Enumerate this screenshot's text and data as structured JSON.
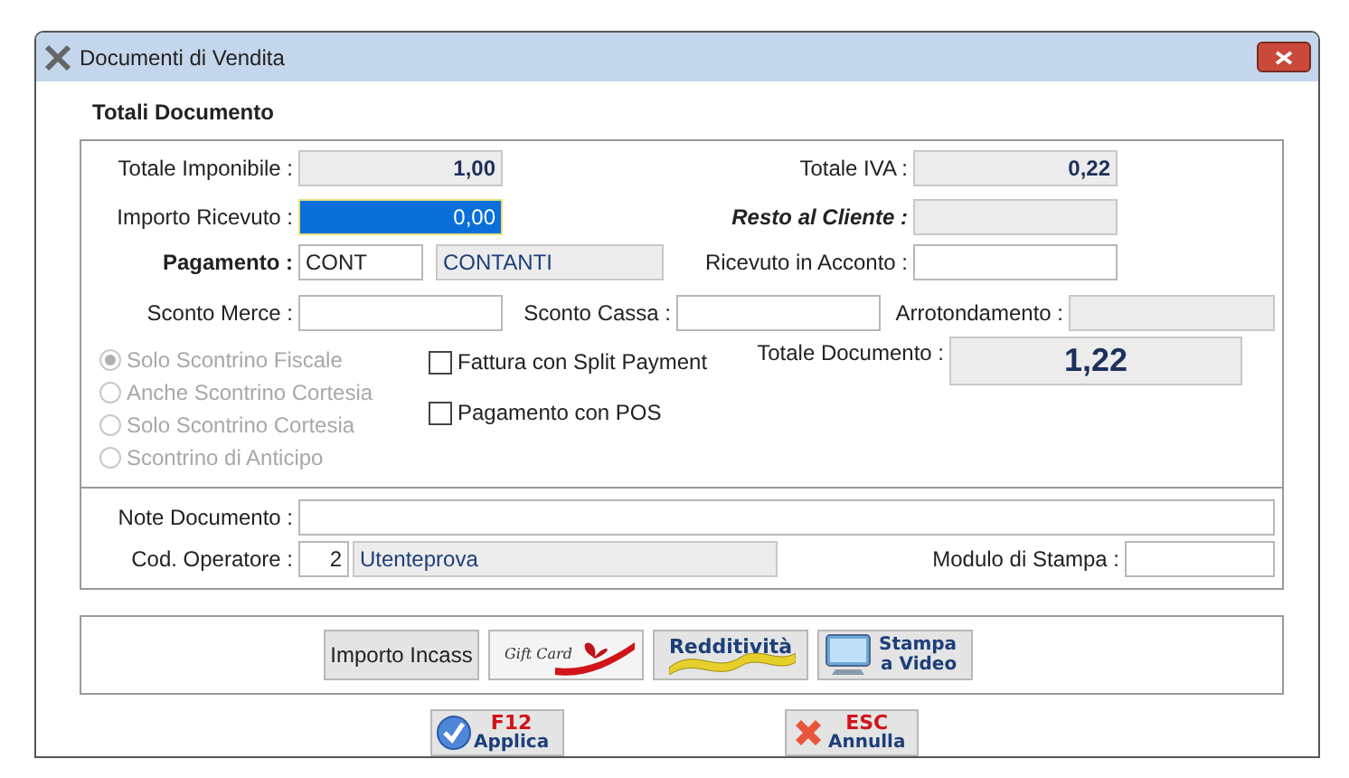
{
  "window": {
    "title": "Documenti di Vendita"
  },
  "section_title": "Totali Documento",
  "totals": {
    "imponibile": {
      "label": "Totale Imponibile :",
      "value": "1,00"
    },
    "iva": {
      "label": "Totale IVA :",
      "value": "0,22"
    },
    "ricevuto": {
      "label": "Importo Ricevuto :",
      "value": "0,00",
      "selected": true
    },
    "resto": {
      "label": "Resto al Cliente :"
    },
    "pagamento": {
      "label": "Pagamento :",
      "code": "CONT",
      "name": "CONTANTI"
    },
    "acconto": {
      "label": "Ricevuto in Acconto :"
    },
    "sconto_merce": {
      "label": "Sconto Merce :"
    },
    "sconto_cassa": {
      "label": "Sconto Cassa :"
    },
    "arrotondamento": {
      "label": "Arrotondamento :"
    }
  },
  "receipt_options": [
    {
      "label": "Solo Scontrino Fiscale",
      "selected": true,
      "disabled": true
    },
    {
      "label": "Anche Scontrino Cortesia",
      "selected": false,
      "disabled": true
    },
    {
      "label": "Solo Scontrino Cortesia",
      "selected": false,
      "disabled": true
    },
    {
      "label": "Scontrino di Anticipo",
      "selected": false,
      "disabled": true
    }
  ],
  "checkboxes": [
    {
      "label": "Fattura con Split Payment",
      "checked": false
    },
    {
      "label": "Pagamento con POS",
      "checked": false
    }
  ],
  "totale_documento": {
    "label": "Totale Documento :",
    "value": "1,22"
  },
  "note": {
    "label": "Note Documento :"
  },
  "operatore": {
    "label": "Cod. Operatore :",
    "code": "2",
    "name": "Utenteprova"
  },
  "modulo": {
    "label": "Modulo di Stampa :"
  },
  "tool_buttons": [
    {
      "kind": "plain",
      "label": "Importo Incass"
    },
    {
      "kind": "giftcard",
      "label": "Gift Card"
    },
    {
      "kind": "tape",
      "label": "Redditività"
    },
    {
      "kind": "monitor",
      "label": "Stampa",
      "label2": "a Video"
    }
  ],
  "actions": [
    {
      "kind": "apply",
      "key": "F12",
      "label": "Applica"
    },
    {
      "kind": "cancel",
      "key": "ESC",
      "label": "Annulla"
    }
  ]
}
